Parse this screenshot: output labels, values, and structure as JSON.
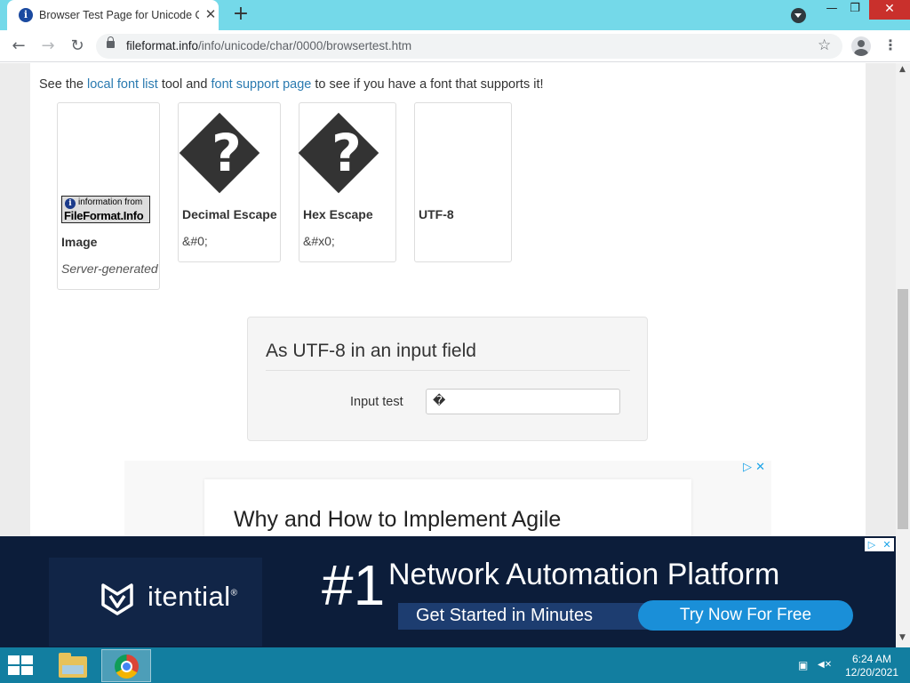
{
  "browser": {
    "tab_title": "Browser Test Page for Unicode C",
    "tab_favicon": "i",
    "close_glyph": "✕",
    "new_tab_glyph": "+",
    "url_host": "fileformat.info",
    "url_path": "/info/unicode/char/0000/browsertest.htm",
    "back_glyph": "←",
    "forward_glyph": "→",
    "reload_glyph": "↻",
    "star_glyph": "☆",
    "menu_glyph": "⋮",
    "minimize_glyph": "—",
    "restore_glyph": "❐",
    "window_close_glyph": "✕"
  },
  "page": {
    "intro_prefix": "See the ",
    "local_font_link": "local font list",
    "intro_mid1": " tool and ",
    "font_support_link": "font support page",
    "intro_suffix": " to see if you have a font that supports it!",
    "cards": [
      {
        "title": "Image",
        "sub": "Server-generated",
        "badge_top": "information from",
        "badge_bottom": "FileFormat.Info",
        "badge_i": "i"
      },
      {
        "title": "Decimal Escape",
        "sub": "&#0;",
        "glyph": "?"
      },
      {
        "title": "Hex Escape",
        "sub": "&#x0;",
        "glyph": "?"
      },
      {
        "title": "UTF-8",
        "sub": ""
      }
    ],
    "input_panel": {
      "legend": "As UTF-8 in an input field",
      "label": "Input test",
      "value": "�"
    },
    "inline_ad": {
      "headline": "Why and How to Implement Agile",
      "choice": "▷ ✕"
    }
  },
  "bottom_ad": {
    "collapse_glyph": "⌄",
    "brand": "itential",
    "brand_mark": "®",
    "number": "#1",
    "headline": "Network Automation Platform",
    "subline": "Get Started in Minutes",
    "cta": "Try Now For Free",
    "choice_play": "▷",
    "choice_close": "✕"
  },
  "scrollbar": {
    "up_glyph": "▲",
    "down_glyph": "▼"
  },
  "taskbar": {
    "time": "6:24 AM",
    "date": "12/20/2021",
    "network_glyph": "▣",
    "volume_glyph": "◀✕"
  },
  "colors": {
    "tabstrip": "#74d9e9",
    "link": "#2a7ab0",
    "taskbar": "#127ea0",
    "banner_bg": "#0c1d3a",
    "cta": "#1a8fd8"
  }
}
